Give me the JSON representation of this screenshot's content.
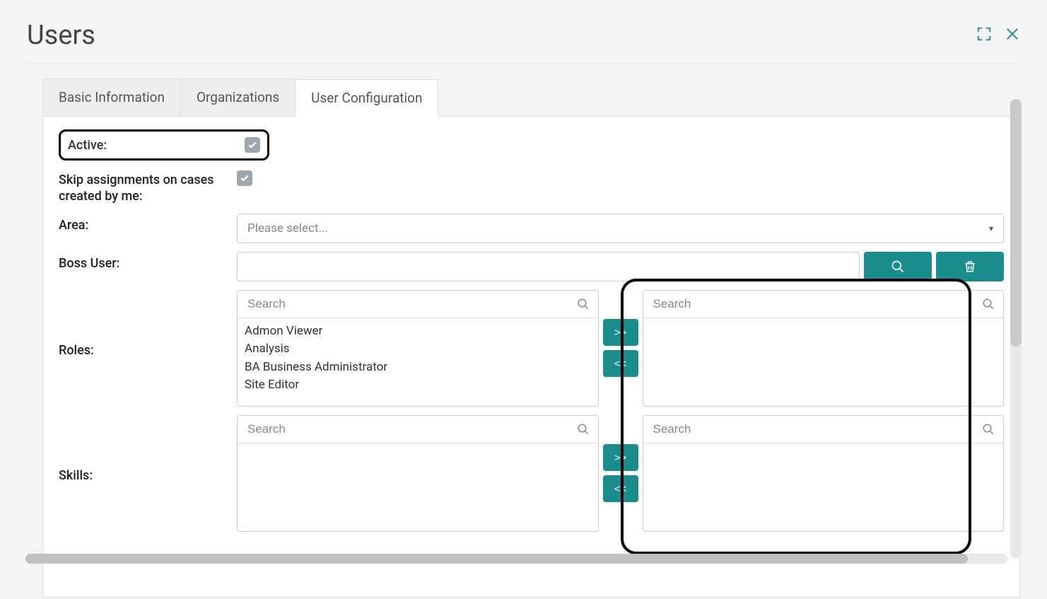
{
  "header": {
    "title": "Users"
  },
  "tabs": [
    {
      "label": "Basic Information",
      "active": false
    },
    {
      "label": "Organizations",
      "active": false
    },
    {
      "label": "User Configuration",
      "active": true
    }
  ],
  "form": {
    "active": {
      "label": "Active:",
      "checked": true
    },
    "skip": {
      "label": "Skip assignments on cases created by me:",
      "checked": true
    },
    "area": {
      "label": "Area:",
      "placeholder": "Please select..."
    },
    "boss": {
      "label": "Boss User:",
      "value": ""
    },
    "roles": {
      "label": "Roles:",
      "search_placeholder": "Search",
      "available": [
        "Admon Viewer",
        "Analysis",
        "BA Business Administrator",
        "Site Editor"
      ],
      "selected_search_placeholder": "Search",
      "add_label": ">>",
      "remove_label": "<<"
    },
    "skills": {
      "label": "Skills:",
      "search_placeholder": "Search",
      "selected_search_placeholder": "Search",
      "add_label": ">>",
      "remove_label": "<<"
    }
  }
}
